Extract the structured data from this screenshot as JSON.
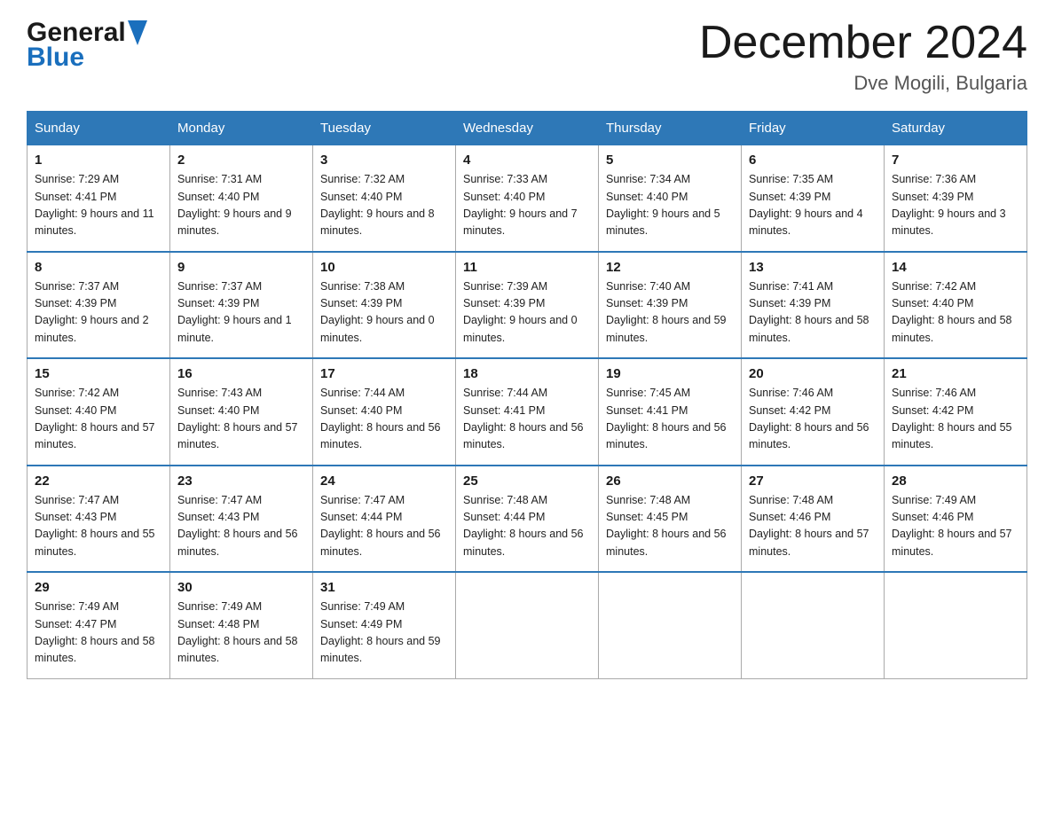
{
  "header": {
    "logo_general": "General",
    "logo_blue": "Blue",
    "month_title": "December 2024",
    "location": "Dve Mogili, Bulgaria"
  },
  "weekdays": [
    "Sunday",
    "Monday",
    "Tuesday",
    "Wednesday",
    "Thursday",
    "Friday",
    "Saturday"
  ],
  "weeks": [
    [
      {
        "day": "1",
        "sunrise": "7:29 AM",
        "sunset": "4:41 PM",
        "daylight": "9 hours and 11 minutes."
      },
      {
        "day": "2",
        "sunrise": "7:31 AM",
        "sunset": "4:40 PM",
        "daylight": "9 hours and 9 minutes."
      },
      {
        "day": "3",
        "sunrise": "7:32 AM",
        "sunset": "4:40 PM",
        "daylight": "9 hours and 8 minutes."
      },
      {
        "day": "4",
        "sunrise": "7:33 AM",
        "sunset": "4:40 PM",
        "daylight": "9 hours and 7 minutes."
      },
      {
        "day": "5",
        "sunrise": "7:34 AM",
        "sunset": "4:40 PM",
        "daylight": "9 hours and 5 minutes."
      },
      {
        "day": "6",
        "sunrise": "7:35 AM",
        "sunset": "4:39 PM",
        "daylight": "9 hours and 4 minutes."
      },
      {
        "day": "7",
        "sunrise": "7:36 AM",
        "sunset": "4:39 PM",
        "daylight": "9 hours and 3 minutes."
      }
    ],
    [
      {
        "day": "8",
        "sunrise": "7:37 AM",
        "sunset": "4:39 PM",
        "daylight": "9 hours and 2 minutes."
      },
      {
        "day": "9",
        "sunrise": "7:37 AM",
        "sunset": "4:39 PM",
        "daylight": "9 hours and 1 minute."
      },
      {
        "day": "10",
        "sunrise": "7:38 AM",
        "sunset": "4:39 PM",
        "daylight": "9 hours and 0 minutes."
      },
      {
        "day": "11",
        "sunrise": "7:39 AM",
        "sunset": "4:39 PM",
        "daylight": "9 hours and 0 minutes."
      },
      {
        "day": "12",
        "sunrise": "7:40 AM",
        "sunset": "4:39 PM",
        "daylight": "8 hours and 59 minutes."
      },
      {
        "day": "13",
        "sunrise": "7:41 AM",
        "sunset": "4:39 PM",
        "daylight": "8 hours and 58 minutes."
      },
      {
        "day": "14",
        "sunrise": "7:42 AM",
        "sunset": "4:40 PM",
        "daylight": "8 hours and 58 minutes."
      }
    ],
    [
      {
        "day": "15",
        "sunrise": "7:42 AM",
        "sunset": "4:40 PM",
        "daylight": "8 hours and 57 minutes."
      },
      {
        "day": "16",
        "sunrise": "7:43 AM",
        "sunset": "4:40 PM",
        "daylight": "8 hours and 57 minutes."
      },
      {
        "day": "17",
        "sunrise": "7:44 AM",
        "sunset": "4:40 PM",
        "daylight": "8 hours and 56 minutes."
      },
      {
        "day": "18",
        "sunrise": "7:44 AM",
        "sunset": "4:41 PM",
        "daylight": "8 hours and 56 minutes."
      },
      {
        "day": "19",
        "sunrise": "7:45 AM",
        "sunset": "4:41 PM",
        "daylight": "8 hours and 56 minutes."
      },
      {
        "day": "20",
        "sunrise": "7:46 AM",
        "sunset": "4:42 PM",
        "daylight": "8 hours and 56 minutes."
      },
      {
        "day": "21",
        "sunrise": "7:46 AM",
        "sunset": "4:42 PM",
        "daylight": "8 hours and 55 minutes."
      }
    ],
    [
      {
        "day": "22",
        "sunrise": "7:47 AM",
        "sunset": "4:43 PM",
        "daylight": "8 hours and 55 minutes."
      },
      {
        "day": "23",
        "sunrise": "7:47 AM",
        "sunset": "4:43 PM",
        "daylight": "8 hours and 56 minutes."
      },
      {
        "day": "24",
        "sunrise": "7:47 AM",
        "sunset": "4:44 PM",
        "daylight": "8 hours and 56 minutes."
      },
      {
        "day": "25",
        "sunrise": "7:48 AM",
        "sunset": "4:44 PM",
        "daylight": "8 hours and 56 minutes."
      },
      {
        "day": "26",
        "sunrise": "7:48 AM",
        "sunset": "4:45 PM",
        "daylight": "8 hours and 56 minutes."
      },
      {
        "day": "27",
        "sunrise": "7:48 AM",
        "sunset": "4:46 PM",
        "daylight": "8 hours and 57 minutes."
      },
      {
        "day": "28",
        "sunrise": "7:49 AM",
        "sunset": "4:46 PM",
        "daylight": "8 hours and 57 minutes."
      }
    ],
    [
      {
        "day": "29",
        "sunrise": "7:49 AM",
        "sunset": "4:47 PM",
        "daylight": "8 hours and 58 minutes."
      },
      {
        "day": "30",
        "sunrise": "7:49 AM",
        "sunset": "4:48 PM",
        "daylight": "8 hours and 58 minutes."
      },
      {
        "day": "31",
        "sunrise": "7:49 AM",
        "sunset": "4:49 PM",
        "daylight": "8 hours and 59 minutes."
      },
      null,
      null,
      null,
      null
    ]
  ],
  "labels": {
    "sunrise": "Sunrise:",
    "sunset": "Sunset:",
    "daylight": "Daylight:"
  }
}
